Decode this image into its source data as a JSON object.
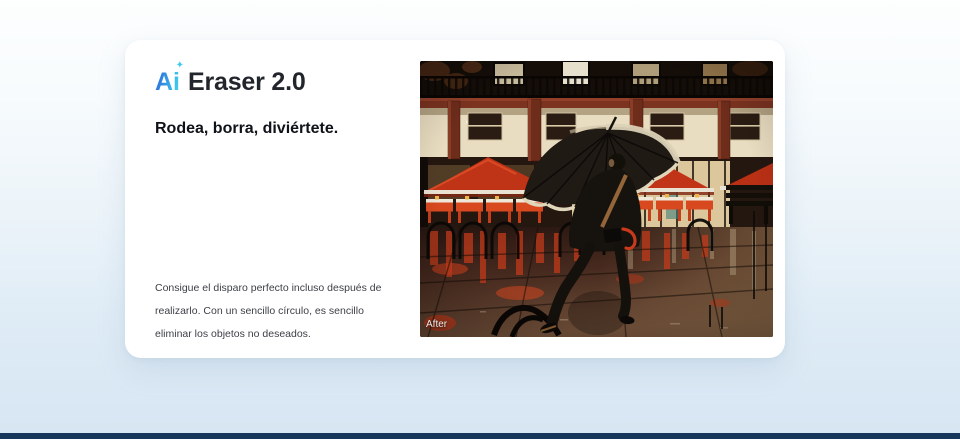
{
  "brand": {
    "name": "Ai",
    "sparkle_glyph": "✦",
    "color_start": "#2f7fde",
    "color_end": "#3ec9ee"
  },
  "card": {
    "title_rest": "Eraser 2.0",
    "subtitle": "Rodea, borra, diviértete.",
    "description": {
      "line1": "Consigue el disparo perfecto incluso después de",
      "line2": "realizarlo. Con un sencillo círculo, es sencillo",
      "line3": "eliminar los objetos no deseados."
    },
    "photo": {
      "badge": "After"
    }
  },
  "page": {
    "footer_bar_color": "#16365c",
    "background_top": "#fdfefe",
    "background_bottom": "#d7e6f2"
  }
}
